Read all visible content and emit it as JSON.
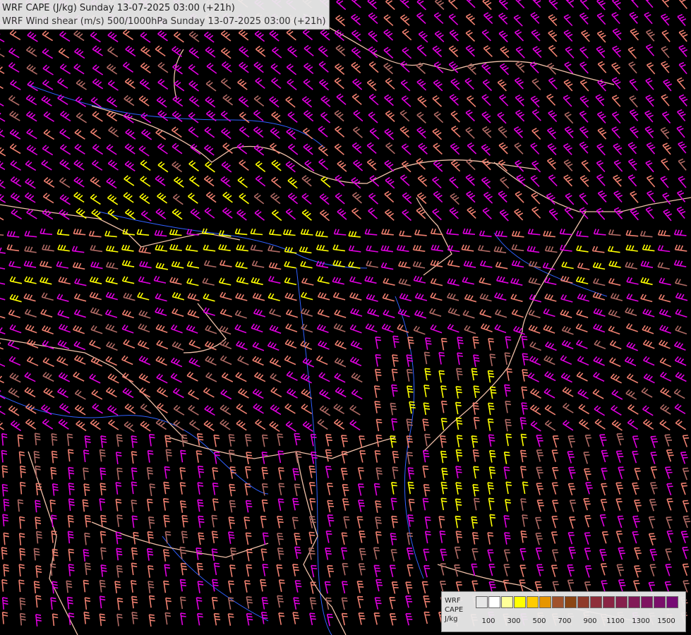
{
  "header": {
    "cape_title": "WRF CAPE (J/kg) Sunday 13-07-2025 03:00 (+21h)",
    "shear_title": "WRF Wind shear (m/s) 500/1000hPa Sunday 13-07-2025 03:00 (+21h)"
  },
  "legend": {
    "model_label": "WRF",
    "field_label": "CAPE",
    "unit_label": "J/kg",
    "ticks": [
      "100",
      "300",
      "500",
      "700",
      "900",
      "1100",
      "1300",
      "1500"
    ],
    "colors": [
      "#e6e6e6",
      "#ffffff",
      "#ffff99",
      "#ffff00",
      "#ffcc00",
      "#e69500",
      "#a0522d",
      "#8b4513",
      "#8f3a2a",
      "#8e2f3a",
      "#8a2444",
      "#86204d",
      "#821a57",
      "#7e1460",
      "#7a0e6a",
      "#760a74"
    ]
  },
  "map": {
    "barb_colors": {
      "magenta": "#e000e0",
      "salmon": "#f08070",
      "brown": "#b06a64",
      "yellow": "#ffff00"
    },
    "border_color": "#f0c0a8",
    "river_color": "#3060ff"
  }
}
